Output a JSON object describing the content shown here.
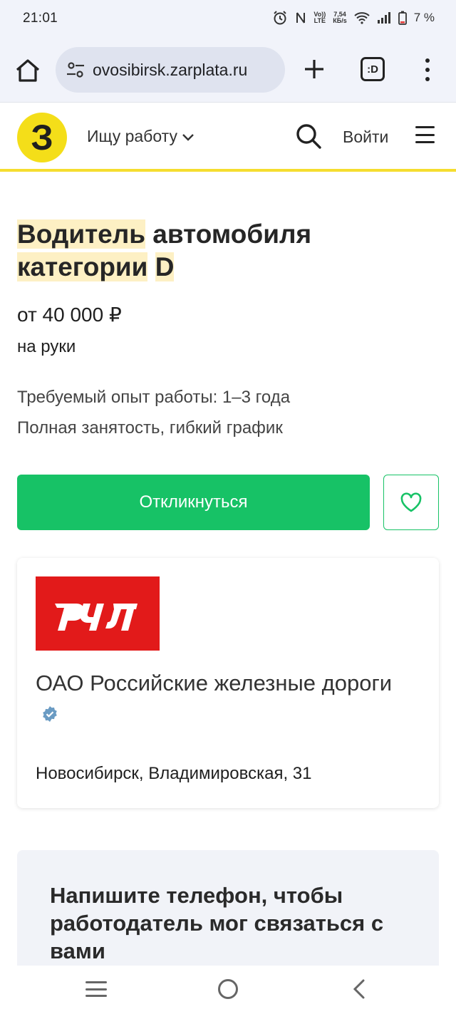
{
  "status_bar": {
    "time": "21:01",
    "net_speed_top": "7,54",
    "net_speed_bottom": "КБ/s",
    "volte_top": "Vo))",
    "volte_bottom": "LTE",
    "battery": "7 %"
  },
  "browser": {
    "url": "новосибирск.zarplata.ru",
    "url_visible": "ovosibirsk.zarplata.ru",
    "tabs_label": ":D"
  },
  "site_header": {
    "logo_letter": "З",
    "job_menu_label": "Ищу работу",
    "login_label": "Войти",
    "accent_color": "#f4de19"
  },
  "vacancy": {
    "title_part1": "Водитель",
    "title_part2": " автомобиля ",
    "title_part3": "категории",
    "title_part4": " ",
    "title_part5": "D",
    "salary": "от 40 000 ₽",
    "salary_note": "на руки",
    "experience": "Требуемый опыт работы: 1–3 года",
    "employment": "Полная занятость, гибкий график",
    "apply_label": "Откликнуться",
    "apply_color": "#17c266"
  },
  "company": {
    "logo_text": "РЖД",
    "logo_color": "#e21a1a",
    "name": "ОАО Российские железные дороги",
    "address": "Новосибирск, Владимировская, 31"
  },
  "phone_block": {
    "title": "Напишите телефон, чтобы работодатель мог связаться с вами"
  }
}
